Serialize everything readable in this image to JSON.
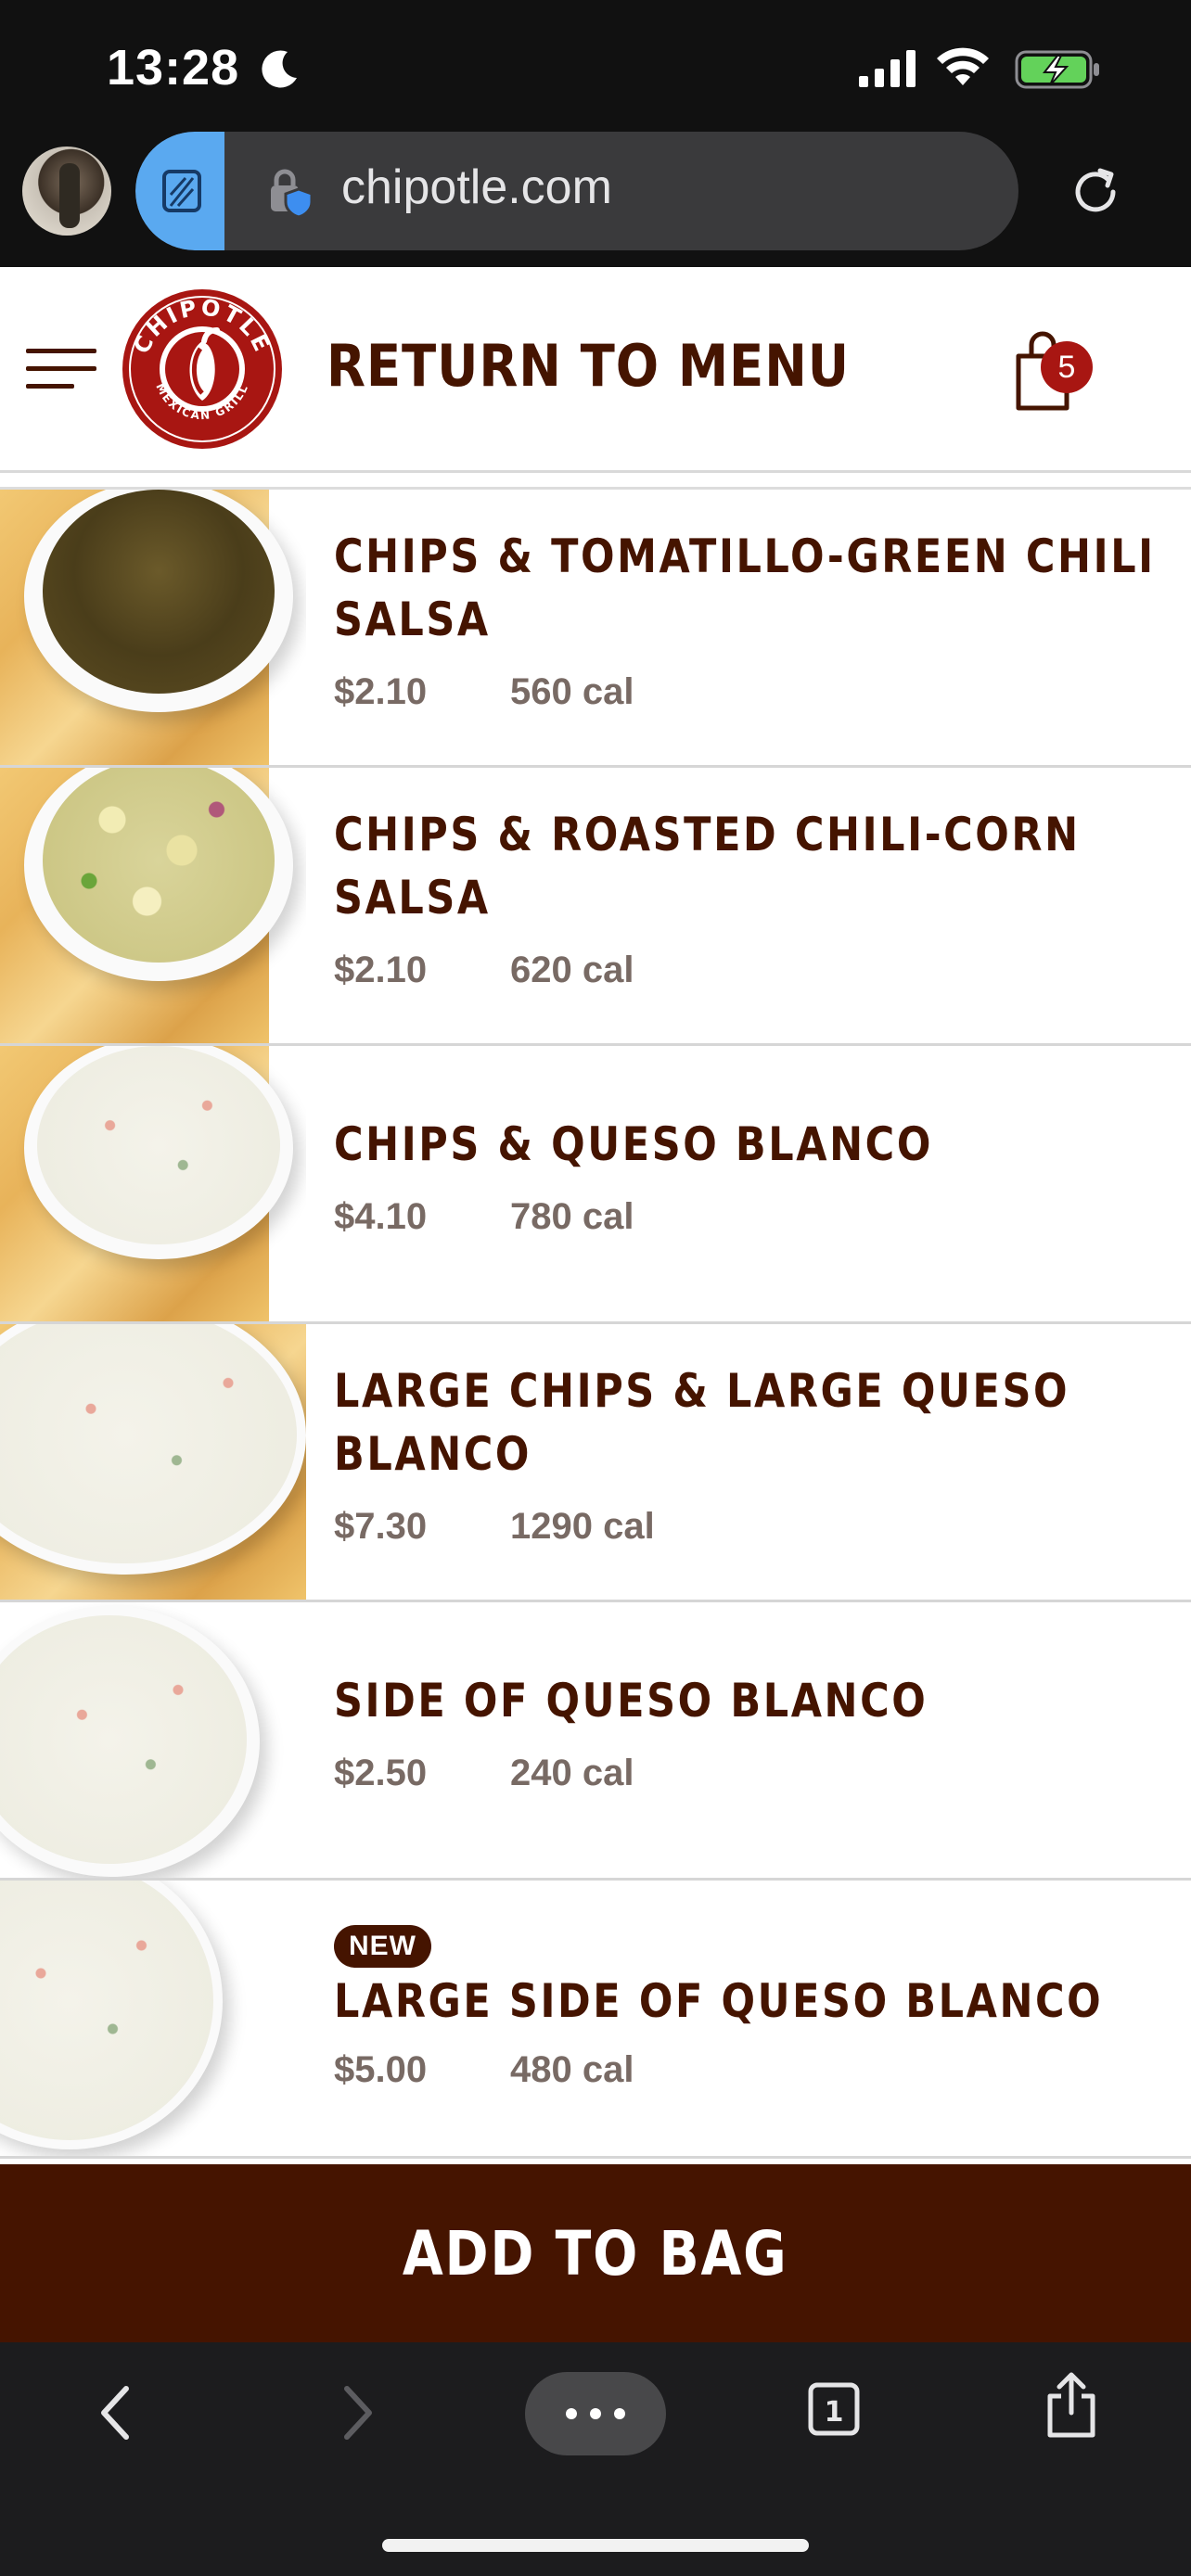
{
  "status_bar": {
    "time": "13:28"
  },
  "browser": {
    "url": "chipotle.com"
  },
  "header": {
    "logo_text_top": "CHIPOTLE",
    "logo_text_bottom": "MEXICAN GRILL",
    "title": "RETURN TO MENU",
    "bag_count": "5"
  },
  "menu_items": [
    {
      "name": "CHIPS & TOMATILLO-GREEN CHILI SALSA",
      "price": "$2.10",
      "calories": "560 cal",
      "badge": ""
    },
    {
      "name": "CHIPS & ROASTED CHILI-CORN SALSA",
      "price": "$2.10",
      "calories": "620 cal",
      "badge": ""
    },
    {
      "name": "CHIPS & QUESO BLANCO",
      "price": "$4.10",
      "calories": "780 cal",
      "badge": ""
    },
    {
      "name": "LARGE CHIPS & LARGE QUESO BLANCO",
      "price": "$7.30",
      "calories": "1290 cal",
      "badge": ""
    },
    {
      "name": "SIDE OF QUESO BLANCO",
      "price": "$2.50",
      "calories": "240 cal",
      "badge": ""
    },
    {
      "name": "LARGE SIDE OF QUESO BLANCO",
      "price": "$5.00",
      "calories": "480 cal",
      "badge": "NEW"
    }
  ],
  "cta": {
    "add_to_bag": "ADD TO BAG"
  },
  "toolbar": {
    "tabs_count": "1",
    "icons": [
      "back-icon",
      "forward-icon",
      "more-icon",
      "tabs-icon",
      "share-icon"
    ]
  },
  "colors": {
    "brand_brown": "#451400",
    "brand_red": "#a81612",
    "chrome_dark": "#111111"
  }
}
